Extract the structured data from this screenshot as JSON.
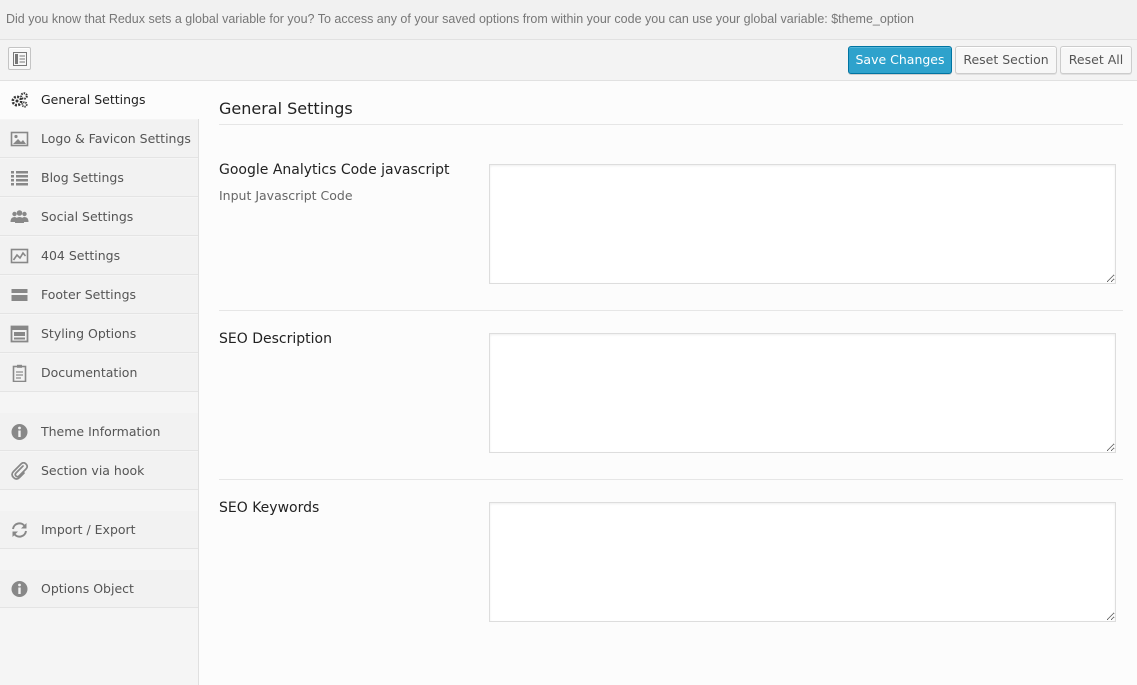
{
  "notice": {
    "text": "Did you know that Redux sets a global variable for you? To access any of your saved options from within your code you can use your global variable: $theme_option"
  },
  "toolbar": {
    "expand_icon": "expand-panel-icon",
    "save_label": "Save Changes",
    "reset_section_label": "Reset Section",
    "reset_all_label": "Reset All"
  },
  "sidebar": {
    "items": [
      {
        "label": "General Settings",
        "icon": "cogs-icon",
        "active": true
      },
      {
        "label": "Logo & Favicon Settings",
        "icon": "picture-icon"
      },
      {
        "label": "Blog Settings",
        "icon": "list-icon"
      },
      {
        "label": "Social Settings",
        "icon": "group-icon"
      },
      {
        "label": "404 Settings",
        "icon": "chart-icon"
      },
      {
        "label": "Footer Settings",
        "icon": "footer-icon"
      },
      {
        "label": "Styling Options",
        "icon": "website-icon"
      },
      {
        "label": "Documentation",
        "icon": "clipboard-icon"
      },
      {
        "label": "Theme Information",
        "icon": "info-icon"
      },
      {
        "label": "Section via hook",
        "icon": "paperclip-icon"
      },
      {
        "label": "Import / Export",
        "icon": "refresh-icon"
      },
      {
        "label": "Options Object",
        "icon": "info-icon"
      }
    ]
  },
  "main": {
    "section_title": "General Settings",
    "fields": [
      {
        "label": "Google Analytics Code javascript",
        "description": "Input Javascript Code",
        "value": ""
      },
      {
        "label": "SEO Description",
        "description": "",
        "value": ""
      },
      {
        "label": "SEO Keywords",
        "description": "",
        "value": ""
      }
    ]
  },
  "colors": {
    "primary": "#2ea2cc",
    "primary_border": "#0074a2",
    "icon": "#888888"
  }
}
